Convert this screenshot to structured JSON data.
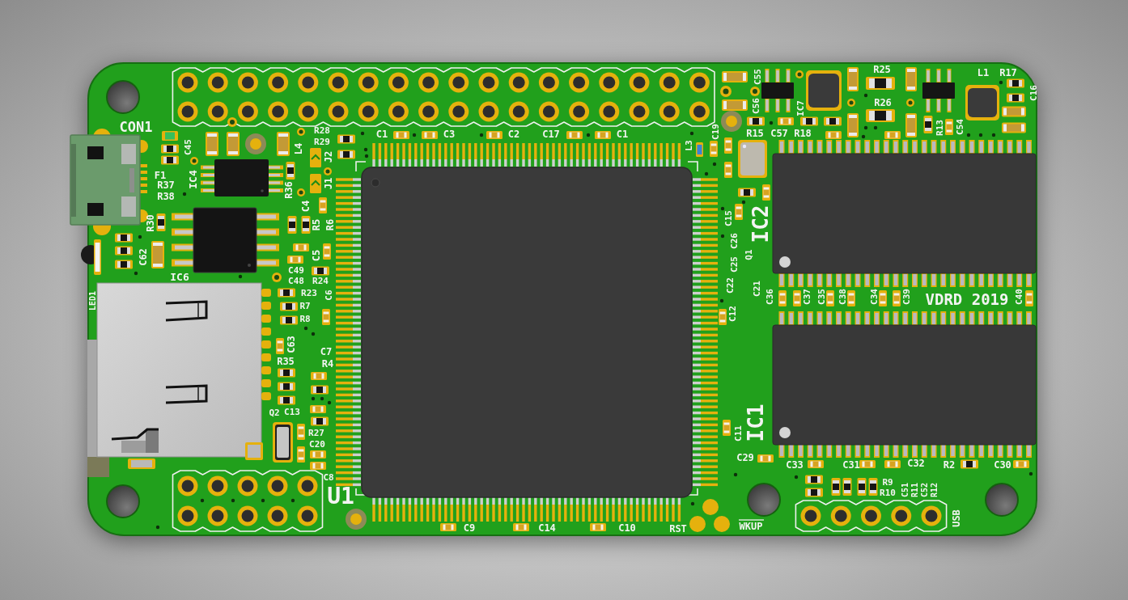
{
  "pcb": {
    "silkscreen_labels": [
      "CON1",
      "F1",
      "R37",
      "R38",
      "C45",
      "IC4",
      "L4",
      "R28",
      "R29",
      "J2",
      "J1",
      "R36",
      "R30",
      "C62",
      "IC6",
      "LED1",
      "C4",
      "R5",
      "R6",
      "C5",
      "C49",
      "C48",
      "R24",
      "R23",
      "R7",
      "R8",
      "C6",
      "C63",
      "R35",
      "C7",
      "R4",
      "Q2",
      "C13",
      "R27",
      "C20",
      "C8",
      "U1",
      "C1",
      "C3",
      "C2",
      "C17",
      "C1",
      "L3",
      "C19",
      "C55",
      "C56",
      "IC7",
      "R15",
      "C57",
      "R18",
      "R25",
      "R26",
      "R13",
      "C54",
      "L1",
      "R17",
      "C16",
      "IC2",
      "C15",
      "C26",
      "C25",
      "Q1",
      "C22",
      "C21",
      "C12",
      "C36",
      "C37",
      "C35",
      "C38",
      "C34",
      "C39",
      "C40",
      "IC1",
      "C11",
      "C29",
      "C33",
      "C31",
      "C32",
      "R2",
      "C30",
      "R9",
      "R10",
      "C51",
      "R11",
      "C52",
      "R12",
      "USB",
      "C9",
      "C14",
      "C10",
      "RST",
      "WKUP"
    ],
    "board_marking": "VDRD 2019"
  }
}
